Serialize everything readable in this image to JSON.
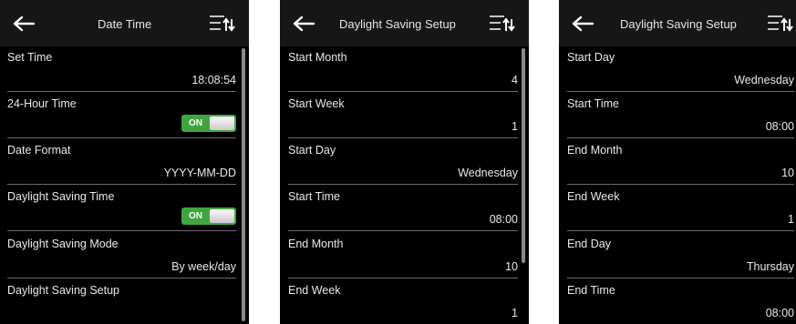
{
  "screens": [
    {
      "title": "Date Time",
      "rows": [
        {
          "label": "Set Time",
          "value": "18:08:54"
        },
        {
          "label": "24-Hour Time",
          "toggle": "ON"
        },
        {
          "label": "Date Format",
          "value": "YYYY-MM-DD"
        },
        {
          "label": "Daylight Saving Time",
          "toggle": "ON"
        },
        {
          "label": "Daylight Saving Mode",
          "value": "By week/day"
        },
        {
          "label": "Daylight Saving Setup"
        }
      ]
    },
    {
      "title": "Daylight Saving Setup",
      "rows": [
        {
          "label": "Start Month",
          "value": "4"
        },
        {
          "label": "Start Week",
          "value": "1"
        },
        {
          "label": "Start Day",
          "value": "Wednesday"
        },
        {
          "label": "Start Time",
          "value": "08:00"
        },
        {
          "label": "End Month",
          "value": "10"
        },
        {
          "label": "End Week",
          "value": "1"
        }
      ]
    },
    {
      "title": "Daylight Saving Setup",
      "rows": [
        {
          "label": "Start Day",
          "value": "Wednesday"
        },
        {
          "label": "Start Time",
          "value": "08:00"
        },
        {
          "label": "End Month",
          "value": "10"
        },
        {
          "label": "End Week",
          "value": "1"
        },
        {
          "label": "End Day",
          "value": "Thursday"
        },
        {
          "label": "End Time",
          "value": "08:00"
        }
      ]
    }
  ],
  "colors": {
    "screen_bg": "#000000",
    "header_bg": "#161616",
    "toggle_on": "#3fa63f",
    "text": "#e8e8e8"
  },
  "icons": {
    "back": "back-arrow-icon",
    "menu": "sort-menu-icon"
  }
}
